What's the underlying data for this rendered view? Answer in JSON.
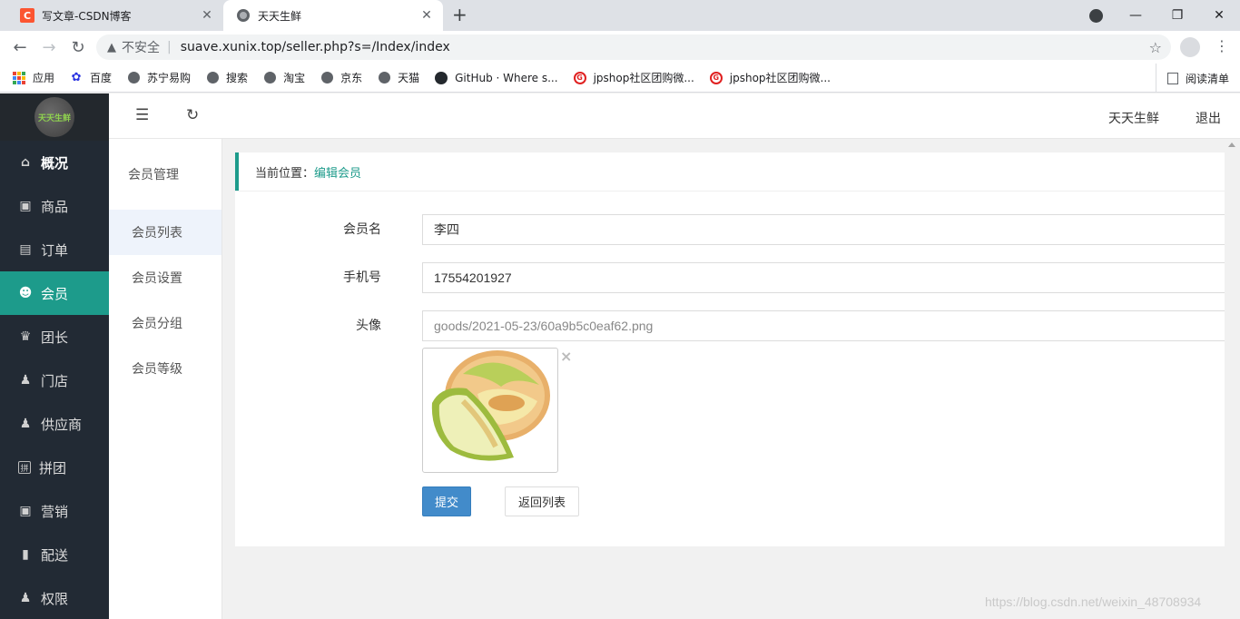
{
  "browser": {
    "tabs": [
      {
        "title": "写文章-CSDN博客",
        "favicon": "C",
        "active": false
      },
      {
        "title": "天天生鲜",
        "active": true
      }
    ],
    "new_tab": "+",
    "address": {
      "security_label": "不安全",
      "url": "suave.xunix.top/seller.php?s=/Index/index"
    },
    "bookmarks": [
      {
        "label": "应用",
        "icon": "apps-icon"
      },
      {
        "label": "百度",
        "icon": "baidu-paw-icon"
      },
      {
        "label": "苏宁易购",
        "icon": "globe-icon"
      },
      {
        "label": "搜索",
        "icon": "globe-icon"
      },
      {
        "label": "淘宝",
        "icon": "globe-icon"
      },
      {
        "label": "京东",
        "icon": "globe-icon"
      },
      {
        "label": "天猫",
        "icon": "globe-icon"
      },
      {
        "label": "GitHub · Where s...",
        "icon": "github-icon"
      },
      {
        "label": "jpshop社区团购微...",
        "icon": "jpshop-icon"
      },
      {
        "label": "jpshop社区团购微...",
        "icon": "jpshop-icon"
      }
    ],
    "reading_list": "阅读清单"
  },
  "app": {
    "logo_text": "天天生鲜",
    "menu": [
      {
        "label": "概况",
        "icon": "home-icon",
        "glyph": "⌂"
      },
      {
        "label": "商品",
        "icon": "inbox-icon",
        "glyph": "▣"
      },
      {
        "label": "订单",
        "icon": "document-icon",
        "glyph": "▤"
      },
      {
        "label": "会员",
        "icon": "users-icon",
        "glyph": "👥"
      },
      {
        "label": "团长",
        "icon": "crown-icon",
        "glyph": "♛"
      },
      {
        "label": "门店",
        "icon": "store-user-icon",
        "glyph": "♟"
      },
      {
        "label": "供应商",
        "icon": "supplier-icon",
        "glyph": "♟"
      },
      {
        "label": "拼团",
        "icon": "group-buy-icon",
        "glyph": "拼"
      },
      {
        "label": "营销",
        "icon": "gift-icon",
        "glyph": "🎁"
      },
      {
        "label": "配送",
        "icon": "truck-icon",
        "glyph": "⛟"
      },
      {
        "label": "权限",
        "icon": "permission-icon",
        "glyph": "♟"
      }
    ],
    "active_menu": "会员",
    "topbar": {
      "shop_name": "天天生鲜",
      "logout": "退出"
    },
    "sub_menu": {
      "title": "会员管理",
      "items": [
        "会员列表",
        "会员设置",
        "会员分组",
        "会员等级"
      ],
      "active": "会员列表"
    },
    "breadcrumb": {
      "prefix": "当前位置：",
      "current": "编辑会员"
    },
    "form": {
      "username_label": "会员名",
      "username_value": "李四",
      "phone_label": "手机号",
      "phone_value": "17554201927",
      "avatar_label": "头像",
      "avatar_value": "goods/2021-05-23/60a9b5c0eaf62.png",
      "remove_image": "×",
      "submit_label": "提交",
      "back_label": "返回列表"
    }
  },
  "watermark": "https://blog.csdn.net/weixin_48708934"
}
